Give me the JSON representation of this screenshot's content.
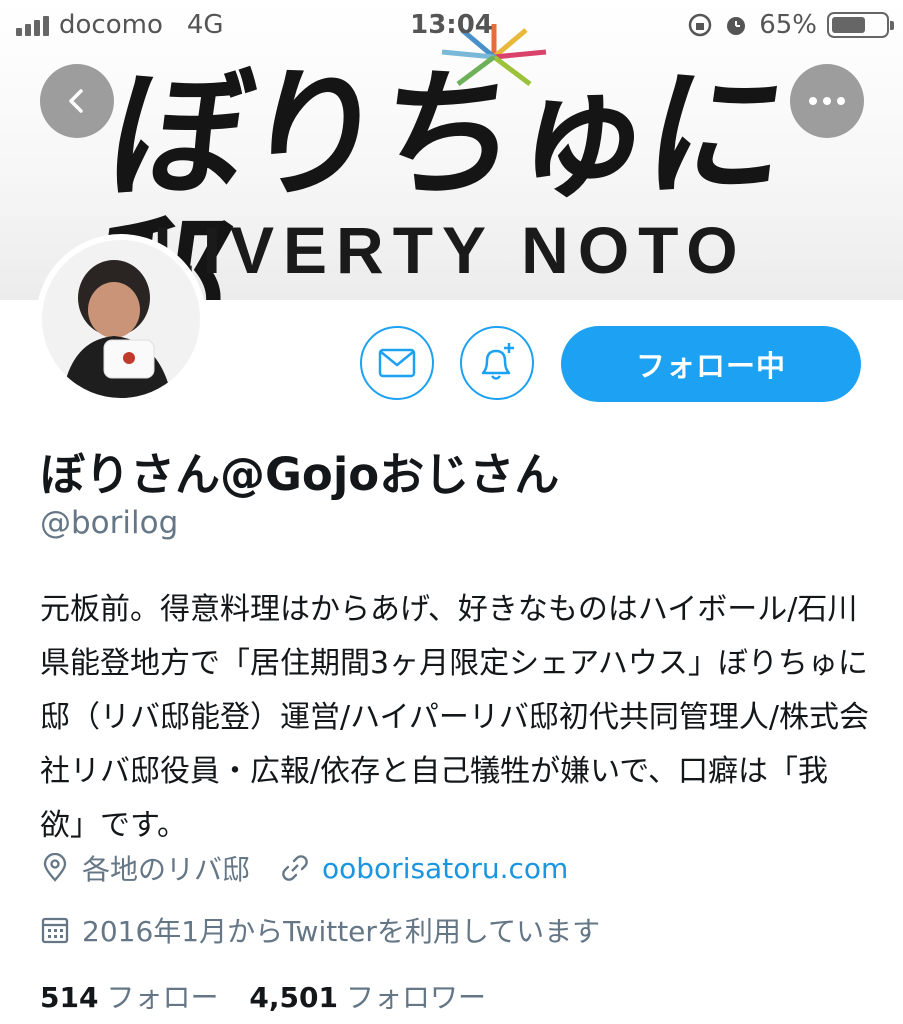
{
  "status_bar": {
    "carrier": "docomo",
    "network": "4G",
    "time": "13:04",
    "battery_percent": "65%",
    "battery_level": 0.65
  },
  "banner": {
    "logo_text": "ぼりちゅに邸",
    "sub_text": "LIVERTY NOTO"
  },
  "icons": {
    "back": "chevron-left-icon",
    "more": "more-dots-icon",
    "dm": "envelope-icon",
    "notify": "bell-plus-icon",
    "location": "location-pin-icon",
    "link": "link-icon",
    "calendar": "calendar-icon"
  },
  "actions": {
    "follow_label": "フォロー中"
  },
  "profile": {
    "name": "ぼりさん@Gojoおじさん",
    "handle": "@borilog",
    "bio": "元板前。得意料理はからあげ、好きなものはハイボール/石川県能登地方で「居住期間3ヶ月限定シェアハウス」ぼりちゅに邸（リバ邸能登）運営/ハイパーリバ邸初代共同管理人/株式会社リバ邸役員・広報/依存と自己犠牲が嫌いで、口癖は「我欲」です。",
    "location": "各地のリバ邸",
    "website": "ooborisatoru.com",
    "joined": "2016年1月からTwitterを利用しています"
  },
  "stats": {
    "following_count": "514",
    "following_label": "フォロー",
    "followers_count": "4,501",
    "followers_label": "フォロワー"
  },
  "colors": {
    "accent": "#1da1f2",
    "link": "#1b95e0",
    "secondary_text": "#657786",
    "primary_text": "#14171a"
  }
}
